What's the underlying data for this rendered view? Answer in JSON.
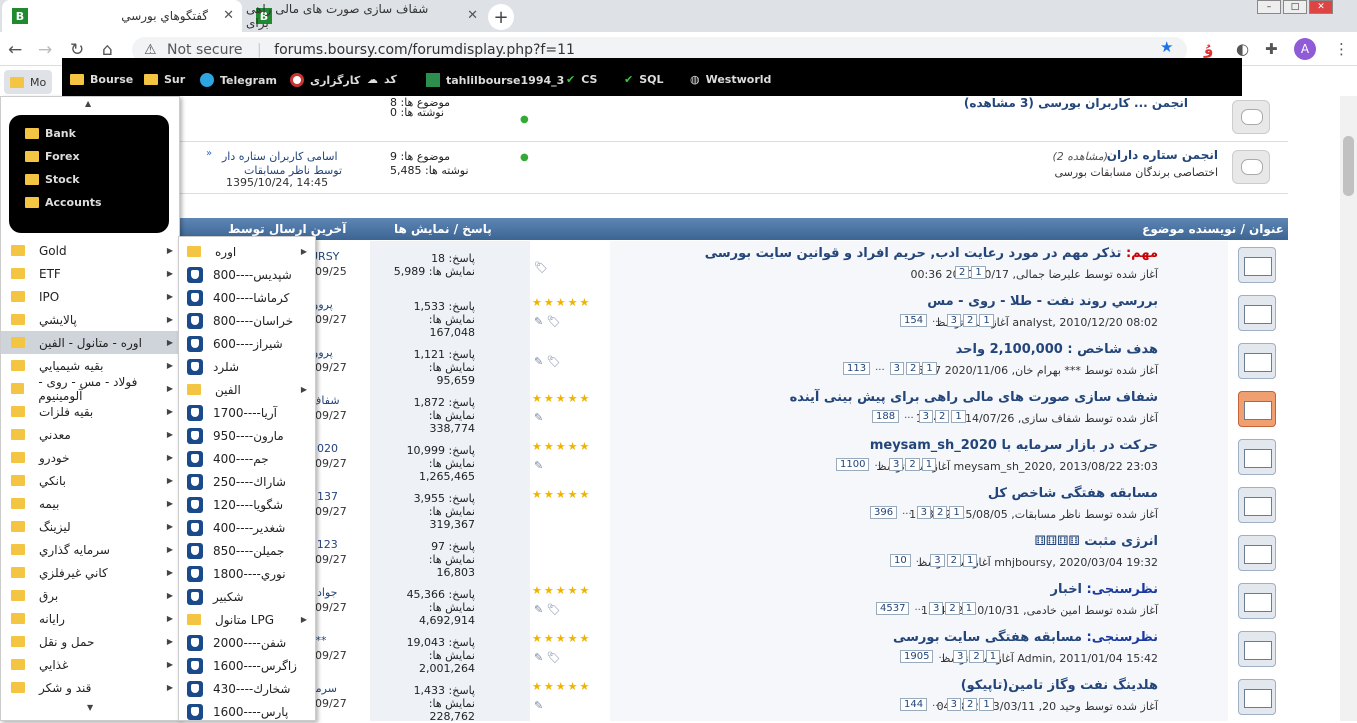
{
  "tabs": [
    {
      "title": "گفتگوهاي بورسي",
      "active": true
    },
    {
      "title": "شفاف سازی صورت های مالی راهی برای",
      "active": false
    }
  ],
  "address": {
    "security": "Not secure",
    "url": "forums.boursy.com/forumdisplay.php?f=11"
  },
  "profile_initial": "A",
  "bookmarks": [
    {
      "label": "Mo",
      "icon": "folder-icon"
    },
    {
      "label": "Bourse",
      "icon": "folder-icon"
    },
    {
      "label": "Sur",
      "icon": "folder-icon"
    },
    {
      "label": "Telegram",
      "icon": "telegram-icon"
    },
    {
      "label": "کارگزاری",
      "icon": "broker-icon"
    },
    {
      "label": "کد",
      "icon": "cloud-icon"
    },
    {
      "label": "tahlilbourse1994_3",
      "icon": "grid-icon"
    },
    {
      "label": "CS",
      "icon": "check-icon"
    },
    {
      "label": "SQL",
      "icon": "check-icon"
    },
    {
      "label": "Westworld",
      "icon": "globe-icon"
    }
  ],
  "forums": [
    {
      "posts": "موضوع ها: 8",
      "replies": "نوشته ها: 0",
      "partial": "انجمن ... کاربران بورسی (3 مشاهده)"
    },
    {
      "name": "انجمن ستاره داران",
      "views": "(2 مشاهده)",
      "desc": "اختصاصی برندگان مسابقات بورسی",
      "topics": "موضوع ها: 9",
      "posts": "نوشته ها: 5,485",
      "last_title": "اسامی کاربران ستاره دار",
      "last_by": "توسط ناظر مسابقات",
      "last_date": "1395/10/24, 14:45"
    }
  ],
  "thead": {
    "title": "عنوان / نویسنده موضوع",
    "replies": "پاسخ / نمایش ها",
    "last": "آخرین ارسال توسط"
  },
  "threads": [
    {
      "prefix": "مهم:",
      "prefix_type": "important",
      "title": "تذکر مهم در مورد رعایت ادب, حریم افراد و قوانین سایت بورسی",
      "by": "آغاز شده توسط علیرضا جمالی, 2020/10/17 00:36",
      "pages": [
        "2",
        "1"
      ],
      "replies": "پاسخ: 18",
      "views": "نمایش ها: 5,989",
      "last_user": "URSY",
      "last_date": "09/25",
      "stars": ""
    },
    {
      "title": "بررسي روند نفت - طلا - روی - مس",
      "by": "analyst, 2010/12/20 08:02 آغاز شده توسط",
      "pages": [
        "154",
        "...",
        "3",
        "2",
        "1"
      ],
      "replies": "پاسخ: 1,533",
      "views": "نمایش ها: 167,048",
      "last_user": "پرووا",
      "last_date": "09/27",
      "stars": "★★★★★"
    },
    {
      "title": "هدف شاخص : 2,100,000 واحد",
      "by": "آغاز شده توسط *** بهرام خان, 2020/11/06 16:27",
      "pages": [
        "113",
        "...",
        "3",
        "2",
        "1"
      ],
      "replies": "پاسخ: 1,121",
      "views": "نمایش ها: 95,659",
      "last_user": "پرووا",
      "last_date": "09/27",
      "stars": ""
    },
    {
      "title": "شفاف سازی صورت های مالی راهی برای پیش بینی آینده",
      "by": "آغاز شده توسط شفاف سازی, 2014/07/26 18:45",
      "pages": [
        "188",
        "...",
        "3",
        "2",
        "1"
      ],
      "replies": "پاسخ: 1,872",
      "views": "نمایش ها: 338,774",
      "last_user": "شفاف",
      "last_date": "09/27",
      "stars": "★★★★★"
    },
    {
      "title": "حرکت در بازار سرمایه با meysam_sh_2020",
      "by": "meysam_sh_2020, 2013/08/22 23:03 آغاز شده توسط",
      "pages": [
        "1100",
        "...",
        "3",
        "2",
        "1"
      ],
      "replies": "پاسخ: 10,999",
      "views": "نمایش ها: 1,265,465",
      "last_user": "2020",
      "last_date": "09/27",
      "stars": "★★★★★"
    },
    {
      "title": "مسابقه هفتگی شاخص کل",
      "by": "آغاز شده توسط ناظر مسابقات, 2015/08/05 11:33",
      "pages": [
        "396",
        "...",
        "3",
        "2",
        "1"
      ],
      "replies": "پاسخ: 3,955",
      "views": "نمایش ها: 319,367",
      "last_user": "d137",
      "last_date": "09/27",
      "stars": "★★★★★"
    },
    {
      "title": "انرژی مثبت ⚅⚅⚅⚅",
      "by": "mhjboursy, 2020/03/04 19:32 آغاز شده توسط",
      "pages": [
        "10",
        "...",
        "3",
        "2",
        "1"
      ],
      "replies": "پاسخ: 97",
      "views": "نمایش ها: 16,803",
      "last_user": "a123",
      "last_date": "09/27",
      "stars": ""
    },
    {
      "prefix": "نظرسنجی:",
      "prefix_type": "poll",
      "title": "اخبار",
      "by": "آغاز شده توسط امین خادمی, 2010/10/31 13:41",
      "pages": [
        "4537",
        "...",
        "3",
        "2",
        "1"
      ],
      "replies": "پاسخ: 45,366",
      "views": "نمایش ها: 4,692,914",
      "last_user": "جواد7",
      "last_date": "09/27",
      "stars": "★★★★★"
    },
    {
      "prefix": "نظرسنجی:",
      "prefix_type": "poll",
      "title": "مسابقه هفتگی سایت بورسی",
      "by": "Admin, 2011/01/04 15:42 آغاز شده توسط",
      "pages": [
        "1905",
        "...",
        "3",
        "2",
        "1"
      ],
      "replies": "پاسخ: 19,043",
      "views": "نمایش ها: 2,001,264",
      "last_user": "***",
      "last_date": "09/27",
      "stars": "★★★★★"
    },
    {
      "title": "هلدینگ نفت وگاز تامین(تاپیکو)",
      "by": "آغاز شده توسط وحید 20, 2013/03/11 04:48",
      "pages": [
        "144",
        "...",
        "3",
        "2",
        "1"
      ],
      "replies": "پاسخ: 1,433",
      "views": "نمایش ها: 228,762",
      "last_user": "سرمد",
      "last_date": "09/27",
      "stars": "★★★★★"
    }
  ],
  "menu1_black": [
    "Bank",
    "Forex",
    "Stock",
    "Accounts"
  ],
  "menu1": [
    {
      "label": "Gold"
    },
    {
      "label": "ETF"
    },
    {
      "label": "IPO"
    },
    {
      "label": "پالايشي"
    },
    {
      "label": "اوره - متانول - الفين",
      "selected": true
    },
    {
      "label": "بقيه شيميايي"
    },
    {
      "label": "فولاد - مس - روی - آلومینیوم"
    },
    {
      "label": "بقيه فلزات"
    },
    {
      "label": "معدني"
    },
    {
      "label": "خودرو"
    },
    {
      "label": "بانكي"
    },
    {
      "label": "بيمه"
    },
    {
      "label": "ليزينگ"
    },
    {
      "label": "سرمايه گذاري"
    },
    {
      "label": "كاني غيرفلزي"
    },
    {
      "label": "برق"
    },
    {
      "label": "رايانه"
    },
    {
      "label": "حمل و نقل"
    },
    {
      "label": "غذايي"
    },
    {
      "label": "قند و شكر"
    }
  ],
  "menu2": [
    {
      "label": "اوره",
      "type": "folder",
      "arrow": true
    },
    {
      "label": "شپديس----800",
      "type": "bourse"
    },
    {
      "label": "كرماشا----400",
      "type": "bourse"
    },
    {
      "label": "خراسان----800",
      "type": "bourse"
    },
    {
      "label": "شيراز----600",
      "type": "bourse"
    },
    {
      "label": "شلرد",
      "type": "bourse"
    },
    {
      "label": "الفين",
      "type": "folder",
      "arrow": true
    },
    {
      "label": "آريا----1700",
      "type": "bourse"
    },
    {
      "label": "مارون----950",
      "type": "bourse"
    },
    {
      "label": "جم----400",
      "type": "bourse"
    },
    {
      "label": "شاراك----250",
      "type": "bourse"
    },
    {
      "label": "شگويا----120",
      "type": "bourse"
    },
    {
      "label": "شغدير----400",
      "type": "bourse"
    },
    {
      "label": "جميلن----850",
      "type": "bourse"
    },
    {
      "label": "نوري----1800",
      "type": "bourse"
    },
    {
      "label": "شكبير",
      "type": "bourse"
    },
    {
      "label": "متانول LPG",
      "type": "folder",
      "arrow": true
    },
    {
      "label": "شفن----2000",
      "type": "bourse"
    },
    {
      "label": "زاگرس----1600",
      "type": "bourse"
    },
    {
      "label": "شخارك----430",
      "type": "bourse"
    },
    {
      "label": "پارس----1600",
      "type": "bourse"
    }
  ]
}
